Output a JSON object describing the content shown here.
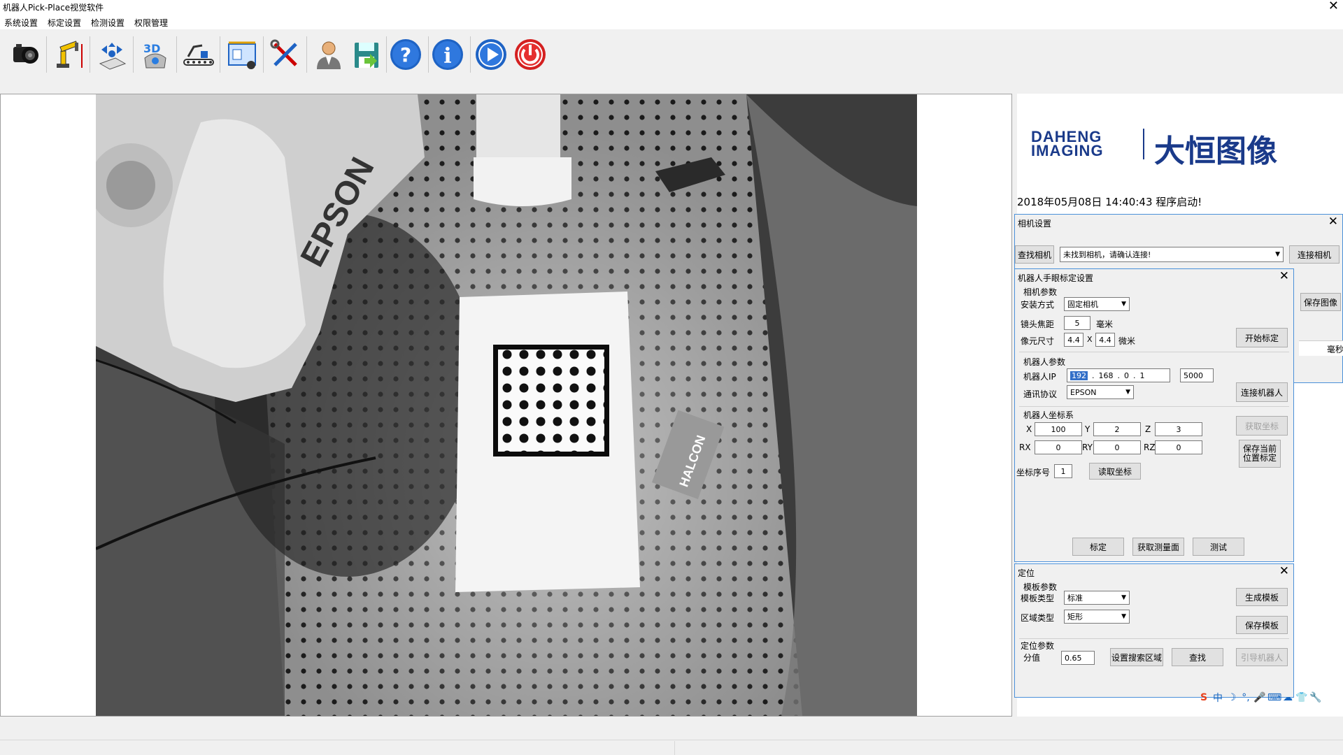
{
  "window": {
    "title": "机器人Pick-Place视觉软件",
    "close_glyph": "✕"
  },
  "menu": {
    "items": [
      "系统设置",
      "标定设置",
      "检测设置",
      "权限管理"
    ]
  },
  "toolbar": {
    "icons": [
      "camera-icon",
      "robot-arm-icon",
      "calibration-icon",
      "3d-icon",
      "conveyor-icon",
      "measure-icon",
      "tools-icon",
      "user-icon",
      "save-icon",
      "help-icon",
      "info-icon",
      "play-icon",
      "power-icon"
    ]
  },
  "logo": {
    "text_en_1": "DAHENG",
    "text_en_2": "IMAGING",
    "text_cn": "大恒图像"
  },
  "status": {
    "message": "2018年05月08日 14:40:43 程序启动!"
  },
  "image_labels": {
    "brand": "EPSON",
    "card": "HALCON"
  },
  "camera_panel": {
    "title": "相机设置",
    "find_button": "查找相机",
    "camera_select": "未找到相机，请确认连接!",
    "connect_button": "连接相机",
    "save_image_button": "保存图像",
    "ms_label": "毫秒"
  },
  "calib_panel": {
    "title": "机器人手眼标定设置",
    "cam_group": "相机参数",
    "mount_label": "安装方式",
    "mount_value": "固定相机",
    "focal_label": "镜头焦距",
    "focal_value": "5",
    "focal_unit": "毫米",
    "pixel_label": "像元尺寸",
    "pixel_x": "4.4",
    "pixel_sep": "X",
    "pixel_y": "4.4",
    "pixel_unit": "微米",
    "start_calib_button": "开始标定",
    "robot_group": "机器人参数",
    "ip_label": "机器人IP",
    "ip": [
      "192",
      "168",
      "0",
      "1"
    ],
    "port": "5000",
    "protocol_label": "通讯协议",
    "protocol_value": "EPSON",
    "connect_robot_button": "连接机器人",
    "coord_group": "机器人坐标系",
    "x_label": "X",
    "x_value": "100",
    "y_label": "Y",
    "y_value": "2",
    "z_label": "Z",
    "z_value": "3",
    "rx_label": "RX",
    "rx_value": "0",
    "ry_label": "RY",
    "ry_value": "0",
    "rz_label": "RZ",
    "rz_value": "0",
    "get_coord_button": "获取坐标",
    "save_pos_button_1": "保存当前",
    "save_pos_button_2": "位置标定",
    "index_label": "坐标序号",
    "index_value": "1",
    "read_coord_button": "读取坐标",
    "calib_button": "标定",
    "measure_button": "获取测量面",
    "test_button": "测试"
  },
  "locate_panel": {
    "title": "定位",
    "template_group": "模板参数",
    "template_type_label": "模板类型",
    "template_type_value": "标准",
    "gen_template_button": "生成模板",
    "region_type_label": "区域类型",
    "region_type_value": "矩形",
    "save_template_button": "保存模板",
    "locate_group": "定位参数",
    "score_label": "分值",
    "score_value": "0.65",
    "search_region_button": "设置搜索区域",
    "find_button": "查找",
    "guide_robot_button": "引导机器人"
  },
  "ime": {
    "items": [
      "S",
      "中",
      "☽",
      "°,",
      "🎤",
      "⌨",
      "☁",
      "👕",
      "🔧"
    ]
  }
}
